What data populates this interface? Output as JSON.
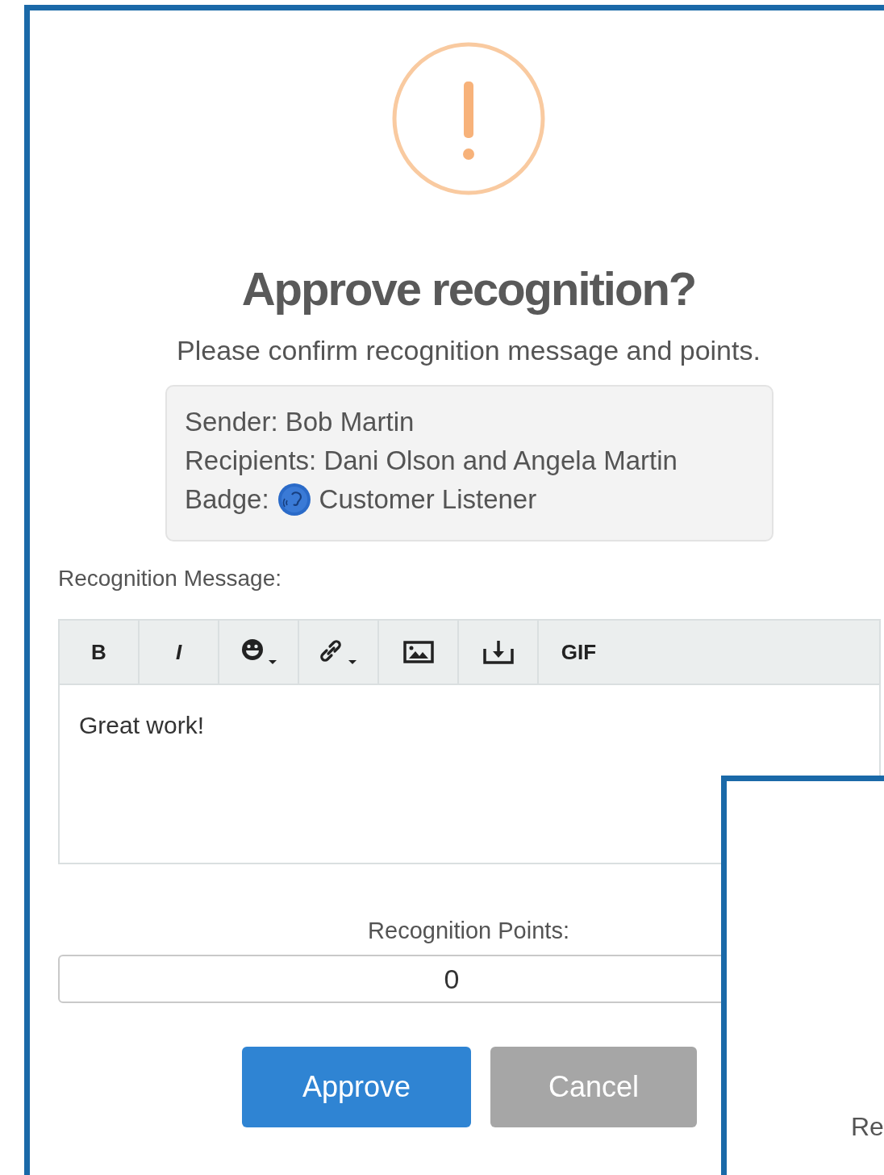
{
  "dialog": {
    "title": "Approve recognition?",
    "subtitle": "Please confirm recognition message and points."
  },
  "details": {
    "sender": "Sender: Bob Martin",
    "recipients": "Recipients: Dani Olson and Angela Martin",
    "badge_label": "Badge:",
    "badge_name": "Customer Listener"
  },
  "message_label": "Recognition Message:",
  "toolbar": [
    {
      "kind": "bold",
      "label": "B"
    },
    {
      "kind": "italic",
      "label": "I"
    },
    {
      "kind": "emoji"
    },
    {
      "kind": "link"
    },
    {
      "kind": "image"
    },
    {
      "kind": "download"
    },
    {
      "kind": "text",
      "label": "GIF"
    }
  ],
  "message": "Great work!",
  "points_label": "Recognition Points:",
  "points": "0",
  "buttons": [
    {
      "kind": "primary",
      "label": "Approve"
    },
    {
      "kind": "secondary",
      "label": "Cancel"
    }
  ],
  "overlay_panel": {
    "text": "Re"
  }
}
